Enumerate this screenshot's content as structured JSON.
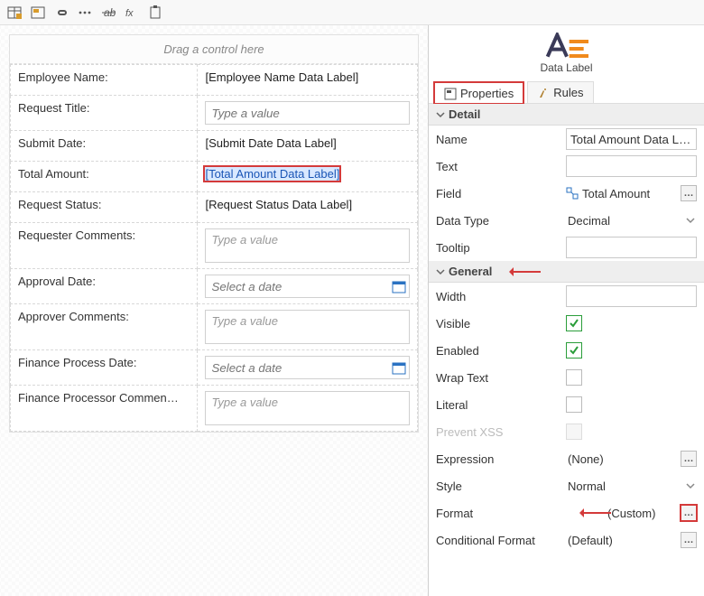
{
  "toolbar": {
    "items": [
      "insert-table",
      "insert-container",
      "link",
      "more",
      "strike",
      "function",
      "paste"
    ]
  },
  "canvas": {
    "drag_hint": "Drag a control here",
    "rows": [
      {
        "label": "Employee Name:",
        "type": "datalabel",
        "value": "[Employee Name Data Label]"
      },
      {
        "label": "Request Title:",
        "type": "textbox",
        "placeholder": "Type a value"
      },
      {
        "label": "Submit Date:",
        "type": "datalabel",
        "value": "[Submit Date Data Label]"
      },
      {
        "label": "Total Amount:",
        "type": "datalabel",
        "value": "[Total Amount Data Label]",
        "selected": true
      },
      {
        "label": "Request Status:",
        "type": "datalabel",
        "value": "[Request Status Data Label]"
      },
      {
        "label": "Requester Comments:",
        "type": "textarea",
        "placeholder": "Type a value"
      },
      {
        "label": "Approval Date:",
        "type": "date",
        "placeholder": "Select a date"
      },
      {
        "label": "Approver Comments:",
        "type": "textarea",
        "placeholder": "Type a value"
      },
      {
        "label": "Finance Process Date:",
        "type": "date",
        "placeholder": "Select a date"
      },
      {
        "label": "Finance Processor Commen…",
        "type": "textarea",
        "placeholder": "Type a value"
      }
    ]
  },
  "props_panel": {
    "control_caption": "Data Label",
    "tabs": {
      "properties": "Properties",
      "rules": "Rules"
    },
    "sections": {
      "detail": "Detail",
      "general": "General"
    },
    "detail": {
      "name_label": "Name",
      "name_value": "Total Amount Data L…",
      "text_label": "Text",
      "text_value": "",
      "field_label": "Field",
      "field_value": "Total Amount",
      "dtype_label": "Data Type",
      "dtype_value": "Decimal",
      "tooltip_label": "Tooltip",
      "tooltip_value": ""
    },
    "general": {
      "width_label": "Width",
      "width_value": "",
      "visible_label": "Visible",
      "visible_value": true,
      "enabled_label": "Enabled",
      "enabled_value": true,
      "wrap_label": "Wrap Text",
      "wrap_value": false,
      "literal_label": "Literal",
      "literal_value": false,
      "xss_label": "Prevent XSS",
      "xss_value": false,
      "expr_label": "Expression",
      "expr_value": "(None)",
      "style_label": "Style",
      "style_value": "Normal",
      "format_label": "Format",
      "format_value": "(Custom)",
      "cond_label": "Conditional Format",
      "cond_value": "(Default)"
    },
    "ellipsis_glyph": "…"
  }
}
